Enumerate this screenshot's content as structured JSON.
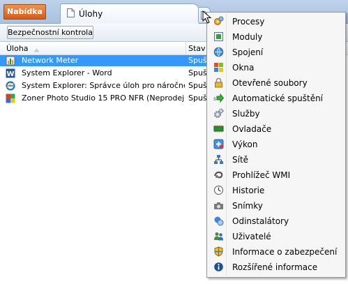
{
  "titlebar": {
    "menu_button": "Nabídka",
    "tab_label": "Úlohy"
  },
  "toolbar": {
    "security_button": "Bezpečnostní kontrola"
  },
  "table": {
    "columns": [
      "Úloha",
      "Stav"
    ],
    "rows": [
      {
        "name": "Network Meter",
        "status": "Spuš",
        "selected": true,
        "icon": "network-meter-icon"
      },
      {
        "name": "System Explorer - Word",
        "status": "Spuš",
        "selected": false,
        "icon": "word-icon"
      },
      {
        "name": "System Explorer: Správce úloh pro náročné zd...",
        "status": "Spuš",
        "selected": false,
        "icon": "internet-explorer-icon"
      },
      {
        "name": "Zoner Photo Studio 15 PRO NFR (Neprodejná...",
        "status": "Spuš",
        "selected": false,
        "icon": "zoner-icon"
      }
    ]
  },
  "popup_menu": {
    "items": [
      {
        "label": "Procesy",
        "icon": "processes-icon"
      },
      {
        "label": "Moduly",
        "icon": "modules-icon"
      },
      {
        "label": "Spojení",
        "icon": "connections-icon"
      },
      {
        "label": "Okna",
        "icon": "windows-icon"
      },
      {
        "label": "Otevřené soubory",
        "icon": "open-files-icon"
      },
      {
        "label": "Automatické spuštění",
        "icon": "autostart-icon"
      },
      {
        "label": "Služby",
        "icon": "services-icon"
      },
      {
        "label": "Ovladače",
        "icon": "drivers-icon"
      },
      {
        "label": "Výkon",
        "icon": "performance-icon"
      },
      {
        "label": "Sítě",
        "icon": "networks-icon"
      },
      {
        "label": "Prohlížeč WMI",
        "icon": "wmi-browser-icon"
      },
      {
        "label": "Historie",
        "icon": "history-icon"
      },
      {
        "label": "Snímky",
        "icon": "snapshots-icon"
      },
      {
        "label": "Odinstalátory",
        "icon": "uninstallers-icon"
      },
      {
        "label": "Uživatelé",
        "icon": "users-icon"
      },
      {
        "label": "Informace o zabezpečení",
        "icon": "security-info-icon"
      },
      {
        "label": "Rozšířené informace",
        "icon": "extended-info-icon"
      }
    ]
  },
  "colors": {
    "selection": "#3399ff",
    "menu_button": "#e06b22",
    "titlebar": "#b4cbe6"
  }
}
